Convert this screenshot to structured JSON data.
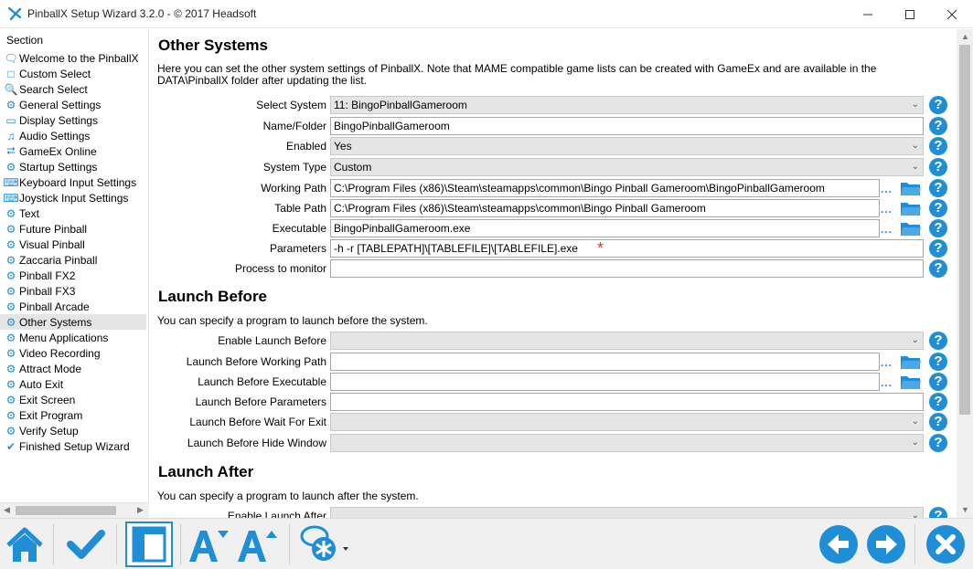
{
  "window": {
    "title": "PinballX Setup Wizard 3.2.0 - © 2017 Headsoft"
  },
  "sidebar": {
    "title": "Section",
    "items": [
      {
        "label": "Welcome to the PinballX",
        "icon": "chat-icon"
      },
      {
        "label": "Custom Select",
        "icon": "window-icon"
      },
      {
        "label": "Search Select",
        "icon": "search-icon"
      },
      {
        "label": "General Settings",
        "icon": "gear-icon"
      },
      {
        "label": "Display Settings",
        "icon": "monitor-icon"
      },
      {
        "label": "Audio Settings",
        "icon": "music-icon"
      },
      {
        "label": "GameEx Online",
        "icon": "network-icon"
      },
      {
        "label": "Startup Settings",
        "icon": "gear-icon"
      },
      {
        "label": "Keyboard Input Settings",
        "icon": "keyboard-icon"
      },
      {
        "label": "Joystick Input Settings",
        "icon": "keyboard-icon"
      },
      {
        "label": "Text",
        "icon": "gear-icon"
      },
      {
        "label": "Future Pinball",
        "icon": "gear-icon"
      },
      {
        "label": "Visual Pinball",
        "icon": "gear-icon"
      },
      {
        "label": "Zaccaria Pinball",
        "icon": "gear-icon"
      },
      {
        "label": "Pinball FX2",
        "icon": "gear-icon"
      },
      {
        "label": "Pinball FX3",
        "icon": "gear-icon"
      },
      {
        "label": "Pinball Arcade",
        "icon": "gear-icon"
      },
      {
        "label": "Other Systems",
        "icon": "gear-icon",
        "active": true
      },
      {
        "label": "Menu Applications",
        "icon": "gear-icon"
      },
      {
        "label": "Video Recording",
        "icon": "gear-icon"
      },
      {
        "label": "Attract Mode",
        "icon": "gear-icon"
      },
      {
        "label": "Auto Exit",
        "icon": "gear-icon"
      },
      {
        "label": "Exit Screen",
        "icon": "gear-icon"
      },
      {
        "label": "Exit Program",
        "icon": "gear-icon"
      },
      {
        "label": "Verify Setup",
        "icon": "gear-icon"
      },
      {
        "label": "Finished Setup Wizard",
        "icon": "check-icon"
      }
    ]
  },
  "other_systems": {
    "heading": "Other Systems",
    "description": "Here you can set the other system settings of PinballX. Note that MAME compatible game lists can be created with GameEx and are available in the DATA\\PinballX folder after updating the list.",
    "select_system": {
      "label": "Select System",
      "value": "11: BingoPinballGameroom"
    },
    "name_folder": {
      "label": "Name/Folder",
      "value": "BingoPinballGameroom"
    },
    "enabled": {
      "label": "Enabled",
      "value": "Yes"
    },
    "system_type": {
      "label": "System Type",
      "value": "Custom"
    },
    "working_path": {
      "label": "Working Path",
      "value": "C:\\Program Files (x86)\\Steam\\steamapps\\common\\Bingo Pinball Gameroom\\BingoPinballGameroom"
    },
    "table_path": {
      "label": "Table Path",
      "value": "C:\\Program Files (x86)\\Steam\\steamapps\\common\\Bingo Pinball Gameroom"
    },
    "executable": {
      "label": "Executable",
      "value": "BingoPinballGameroom.exe"
    },
    "parameters": {
      "label": "Parameters",
      "value": "-h -r [TABLEPATH]\\[TABLEFILE]\\[TABLEFILE].exe"
    },
    "process_to_monitor": {
      "label": "Process to monitor",
      "value": ""
    }
  },
  "launch_before": {
    "heading": "Launch Before",
    "description": "You can specify a program to launch before the system.",
    "enable": {
      "label": "Enable Launch Before",
      "value": ""
    },
    "working_path": {
      "label": "Launch Before Working Path",
      "value": ""
    },
    "executable": {
      "label": "Launch Before Executable",
      "value": ""
    },
    "parameters": {
      "label": "Launch Before Parameters",
      "value": ""
    },
    "wait_for_exit": {
      "label": "Launch Before Wait For Exit",
      "value": ""
    },
    "hide_window": {
      "label": "Launch Before Hide Window",
      "value": ""
    }
  },
  "launch_after": {
    "heading": "Launch After",
    "description": "You can specify a program to launch after the system.",
    "enable": {
      "label": "Enable Launch After",
      "value": ""
    }
  },
  "colors": {
    "accent": "#1f8ed6",
    "required_star": "#e53935"
  },
  "symbols": {
    "help": "?",
    "required": "*",
    "dots": "...",
    "chevron": "⌄"
  },
  "toolbar": {
    "buttons": [
      "home-icon",
      "checkmark-icon",
      "layout-icon",
      "font-decrease-icon",
      "font-increase-icon",
      "chat-settings-icon",
      "back-icon",
      "forward-icon",
      "close-icon"
    ]
  }
}
